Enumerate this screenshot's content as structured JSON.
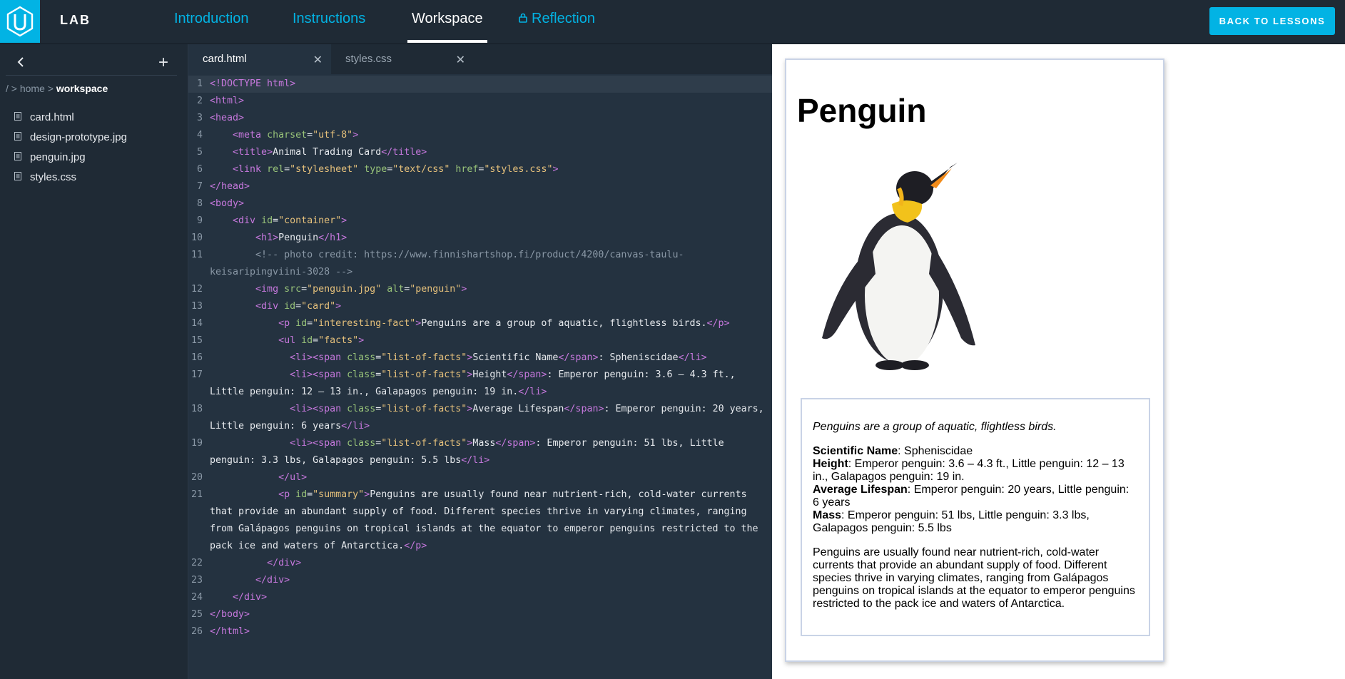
{
  "app": {
    "lab_label": "LAB",
    "back_button": "BACK TO LESSONS",
    "nav_tabs": [
      "Introduction",
      "Instructions",
      "Workspace",
      "Reflection"
    ]
  },
  "sidebar": {
    "breadcrumb_root": "/",
    "breadcrumb_sep": ">",
    "breadcrumb_home": "home",
    "breadcrumb_current": "workspace",
    "files": [
      "card.html",
      "design-prototype.jpg",
      "penguin.jpg",
      "styles.css"
    ]
  },
  "editor": {
    "tabs": [
      "card.html",
      "styles.css"
    ],
    "lines": [
      {
        "n": "1",
        "t": "<!DOCTYPE html>"
      },
      {
        "n": "2",
        "t": "<html>"
      },
      {
        "n": "3",
        "t": "<head>"
      },
      {
        "n": "4",
        "t": "    <meta charset=\"utf-8\">"
      },
      {
        "n": "5",
        "t": "    <title>Animal Trading Card</title>"
      },
      {
        "n": "6",
        "t": "    <link rel=\"stylesheet\" type=\"text/css\" href=\"styles.css\">"
      },
      {
        "n": "7",
        "t": "</head>"
      },
      {
        "n": "8",
        "t": "<body>"
      },
      {
        "n": "9",
        "t": "    <div id=\"container\">"
      },
      {
        "n": "10",
        "t": "        <h1>Penguin</h1>"
      },
      {
        "n": "11",
        "t": "        <!-- photo credit: https://www.finnishartshop.fi/product/4200/canvas-taulu-keisaripingviini-3028 -->"
      },
      {
        "n": "12",
        "t": "        <img src=\"penguin.jpg\" alt=\"penguin\">"
      },
      {
        "n": "13",
        "t": "        <div id=\"card\">"
      },
      {
        "n": "14",
        "t": "            <p id=\"interesting-fact\">Penguins are a group of aquatic, flightless birds.</p>"
      },
      {
        "n": "15",
        "t": "            <ul id=\"facts\">"
      },
      {
        "n": "16",
        "t": "              <li><span class=\"list-of-facts\">Scientific Name</span>: Spheniscidae</li>"
      },
      {
        "n": "17",
        "t": "              <li><span class=\"list-of-facts\">Height</span>: Emperor penguin: 3.6 – 4.3 ft., Little penguin: 12 – 13 in., Galapagos penguin: 19 in.</li>"
      },
      {
        "n": "18",
        "t": "              <li><span class=\"list-of-facts\">Average Lifespan</span>: Emperor penguin: 20 years, Little penguin: 6 years</li>"
      },
      {
        "n": "19",
        "t": "              <li><span class=\"list-of-facts\">Mass</span>: Emperor penguin: 51 lbs, Little penguin: 3.3 lbs, Galapagos penguin: 5.5 lbs</li>"
      },
      {
        "n": "20",
        "t": "            </ul>"
      },
      {
        "n": "21",
        "t": "            <p id=\"summary\">Penguins are usually found near nutrient-rich, cold-water currents that provide an abundant supply of food. Different species thrive in varying climates, ranging from Galápagos penguins on tropical islands at the equator to emperor penguins restricted to the pack ice and waters of Antarctica.</p>"
      },
      {
        "n": "22",
        "t": "          </div>"
      },
      {
        "n": "23",
        "t": "        </div>"
      },
      {
        "n": "24",
        "t": "    </div>"
      },
      {
        "n": "25",
        "t": "</body>"
      },
      {
        "n": "26",
        "t": "</html>"
      }
    ]
  },
  "preview": {
    "title": "Penguin",
    "image_alt": "penguin",
    "fact": "Penguins are a group of aquatic, flightless birds.",
    "facts": [
      {
        "label": "Scientific Name",
        "value": ": Spheniscidae"
      },
      {
        "label": "Height",
        "value": ": Emperor penguin: 3.6 – 4.3 ft., Little penguin: 12 – 13 in., Galapagos penguin: 19 in."
      },
      {
        "label": "Average Lifespan",
        "value": ": Emperor penguin: 20 years, Little penguin: 6 years"
      },
      {
        "label": "Mass",
        "value": ": Emperor penguin: 51 lbs, Little penguin: 3.3 lbs, Galapagos penguin: 5.5 lbs"
      }
    ],
    "summary": "Penguins are usually found near nutrient-rich, cold-water currents that provide an abundant supply of food. Different species thrive in varying climates, ranging from Galápagos penguins on tropical islands at the equator to emperor penguins restricted to the pack ice and waters of Antarctica."
  },
  "colors": {
    "accent": "#02b3e4",
    "nav_bg": "#1f2a35",
    "editor_bg": "#243240"
  }
}
